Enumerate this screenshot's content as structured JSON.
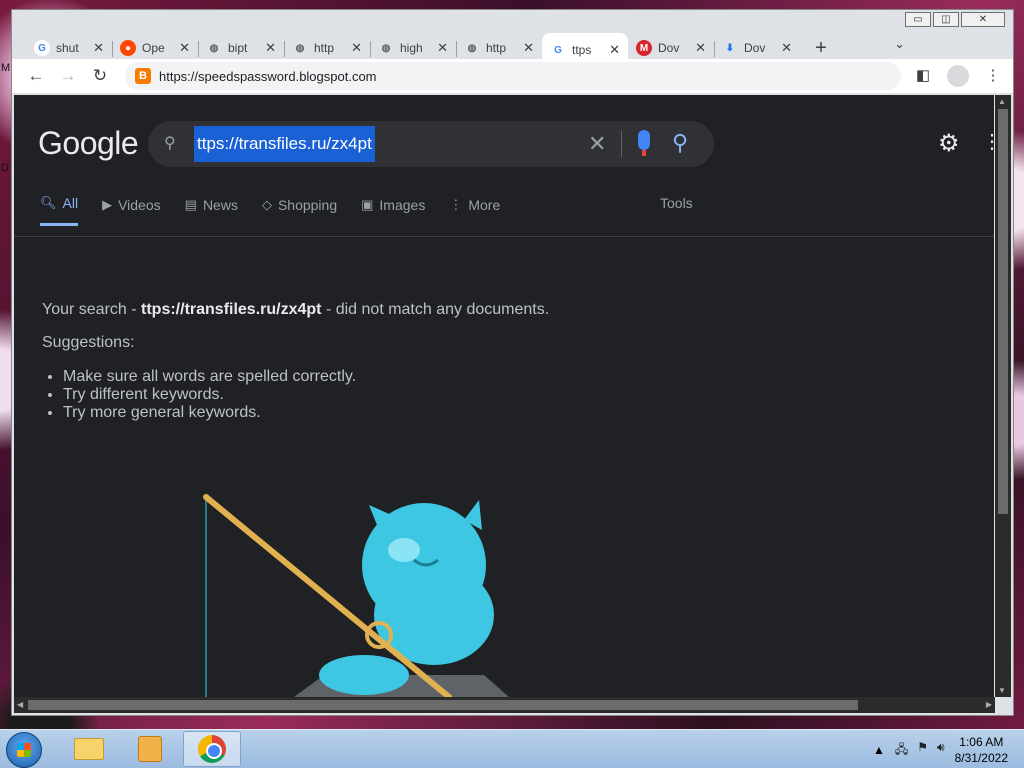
{
  "desktop": {
    "letters": [
      "M",
      "D"
    ]
  },
  "window": {
    "min": "▭",
    "restore": "◫",
    "close": "✕"
  },
  "tabs": [
    {
      "title": "shut",
      "icon": "google-icon",
      "fav": "G",
      "fav_color": "#4285f4",
      "fav_bg": "#ffffff"
    },
    {
      "title": "Ope",
      "icon": "reddit-icon",
      "fav": "●",
      "fav_color": "#ffffff",
      "fav_bg": "#ff4500"
    },
    {
      "title": "bipt",
      "icon": "globe-icon",
      "fav": "◍",
      "fav_color": "#5f6368",
      "fav_bg": "transparent"
    },
    {
      "title": "http",
      "icon": "globe-icon",
      "fav": "◍",
      "fav_color": "#5f6368",
      "fav_bg": "transparent"
    },
    {
      "title": "high",
      "icon": "globe-icon",
      "fav": "◍",
      "fav_color": "#5f6368",
      "fav_bg": "transparent"
    },
    {
      "title": "http",
      "icon": "globe-icon",
      "fav": "◍",
      "fav_color": "#5f6368",
      "fav_bg": "transparent"
    },
    {
      "title": "ttps",
      "icon": "google-icon",
      "fav": "G",
      "fav_color": "#4285f4",
      "fav_bg": "#ffffff",
      "active": true
    },
    {
      "title": "Dov",
      "icon": "mega-icon",
      "fav": "M",
      "fav_color": "#ffffff",
      "fav_bg": "#d9272e"
    },
    {
      "title": "Dov",
      "icon": "download-icon",
      "fav": "⬇",
      "fav_color": "#1a73e8",
      "fav_bg": "transparent"
    }
  ],
  "tabstrip": {
    "new_tab": "+",
    "tab_list": "⌄"
  },
  "toolbar": {
    "back": "←",
    "forward": "→",
    "reload": "↻",
    "url": "https://speedspassword.blogspot.com",
    "site_icon": "B"
  },
  "google": {
    "logo": "Google",
    "query": "ttps://transfiles.ru/zx4pt",
    "clear": "✕",
    "search_glyph": "⚲",
    "settings": "⚙",
    "more_menu": "⋮"
  },
  "search_tabs": [
    {
      "label": "All",
      "icon": "search-icon",
      "glyph": "🔍︎",
      "active": true
    },
    {
      "label": "Videos",
      "icon": "play-icon",
      "glyph": "▶"
    },
    {
      "label": "News",
      "icon": "news-icon",
      "glyph": "▤"
    },
    {
      "label": "Shopping",
      "icon": "tag-icon",
      "glyph": "◇"
    },
    {
      "label": "Images",
      "icon": "image-icon",
      "glyph": "▣"
    },
    {
      "label": "More",
      "icon": "kebab-icon",
      "glyph": "⋮"
    }
  ],
  "tools": "Tools",
  "results": {
    "prefix": "Your search - ",
    "query": "ttps://transfiles.ru/zx4pt",
    "suffix": " - did not match any documents.",
    "suggestions_label": "Suggestions:",
    "suggestions": [
      "Make sure all words are spelled correctly.",
      "Try different keywords.",
      "Try more general keywords."
    ]
  },
  "taskbar": {
    "apps": [
      {
        "name": "explorer"
      },
      {
        "name": "media-player"
      },
      {
        "name": "chrome",
        "active": true
      }
    ],
    "tray_arrow": "▲",
    "time": "1:06 AM",
    "date": "8/31/2022"
  }
}
